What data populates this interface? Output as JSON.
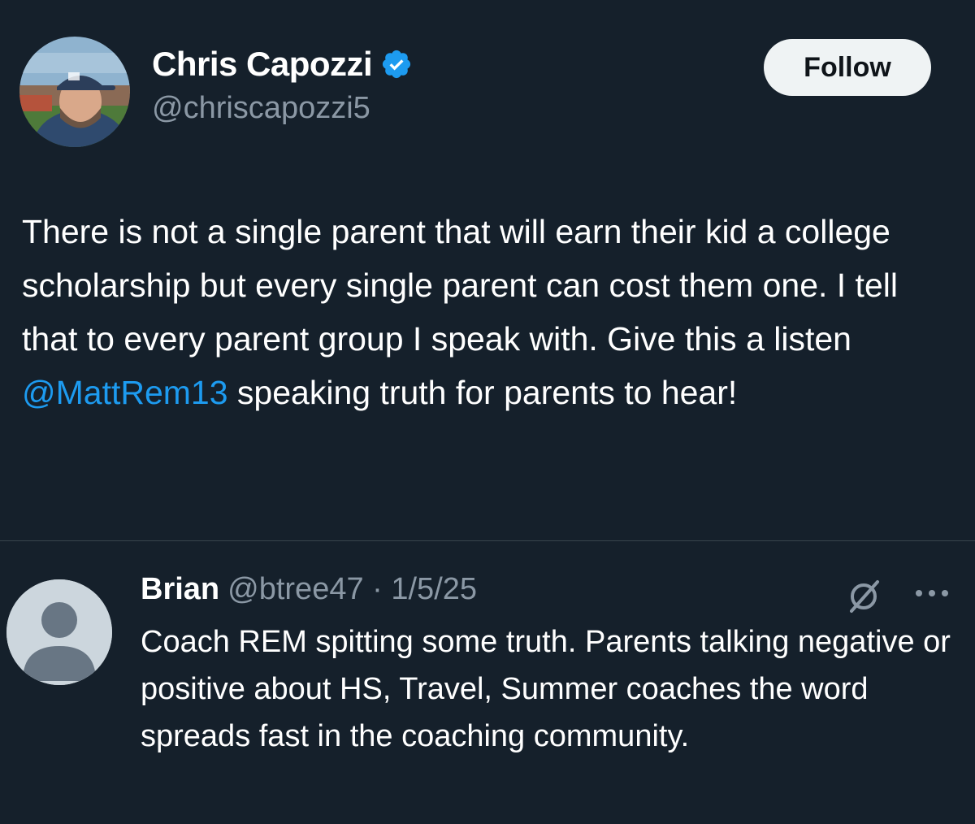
{
  "post": {
    "author": {
      "name": "Chris Capozzi",
      "handle": "@chriscapozzi5",
      "verified": true,
      "avatar": "profile-photo-man-in-cap"
    },
    "follow_label": "Follow",
    "text_parts": {
      "before_mention": "There is not a single parent that will earn their kid a college scholarship but every single parent can cost them one. I tell that to every parent group I speak with. Give this a listen ",
      "mention": "@MattRem13",
      "after_mention": " speaking truth for parents to hear!"
    }
  },
  "reply": {
    "name": "Brian",
    "meta": "@btree47 · 1/5/25",
    "avatar": "default-avatar",
    "text": "Coach REM spitting some truth.  Parents talking negative or positive about HS, Travel, Summer coaches the word spreads fast in the coaching community.",
    "icons": [
      "grok-icon",
      "more-icon"
    ]
  },
  "colors": {
    "background": "#15202b",
    "text": "#ffffff",
    "secondary_text": "#8b98a5",
    "link": "#1d9bf0",
    "verified_badge": "#1d9bf0",
    "follow_button_bg": "#eff3f4"
  }
}
